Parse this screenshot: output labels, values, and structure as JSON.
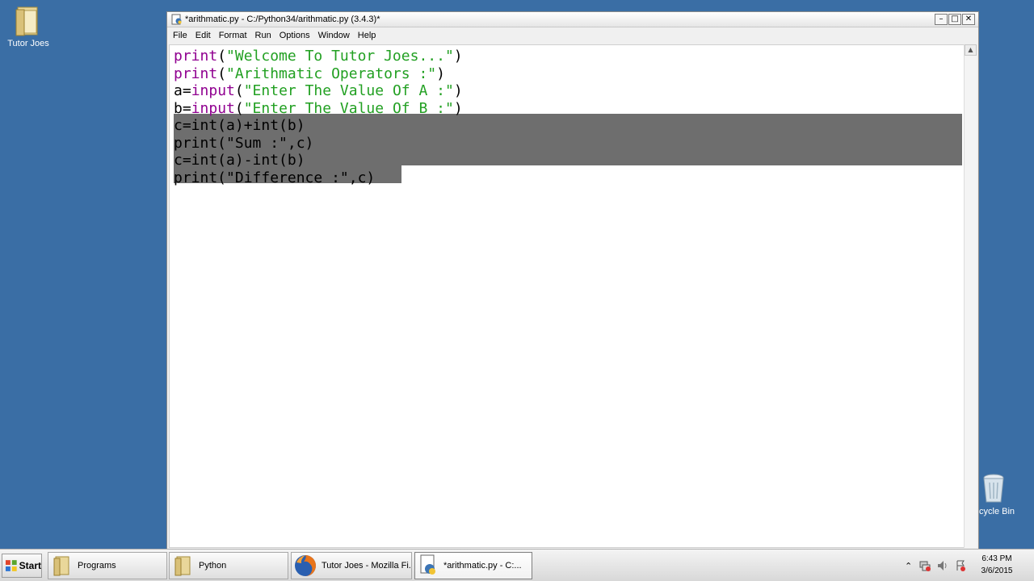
{
  "desktop": {
    "icons": [
      {
        "label": "Tutor Joes"
      },
      {
        "label": "cycle Bin"
      }
    ]
  },
  "window": {
    "title": "*arithmatic.py - C:/Python34/arithmatic.py (3.4.3)*",
    "controls": {
      "minimize": "–",
      "maximize": "□",
      "close": "✕"
    },
    "menu": [
      "File",
      "Edit",
      "Format",
      "Run",
      "Options",
      "Window",
      "Help"
    ]
  },
  "editor": {
    "lines": [
      [
        {
          "t": "print",
          "c": "kw"
        },
        {
          "t": "(",
          "c": "plain"
        },
        {
          "t": "\"Welcome To Tutor Joes...\"",
          "c": "str"
        },
        {
          "t": ")",
          "c": "plain"
        }
      ],
      [
        {
          "t": "print",
          "c": "kw"
        },
        {
          "t": "(",
          "c": "plain"
        },
        {
          "t": "\"Arithmatic Operators :\"",
          "c": "str"
        },
        {
          "t": ")",
          "c": "plain"
        }
      ],
      [
        {
          "t": "a=",
          "c": "plain"
        },
        {
          "t": "input",
          "c": "kw"
        },
        {
          "t": "(",
          "c": "plain"
        },
        {
          "t": "\"Enter The Value Of A :\"",
          "c": "str"
        },
        {
          "t": ")",
          "c": "plain"
        }
      ],
      [
        {
          "t": "b=",
          "c": "plain"
        },
        {
          "t": "input",
          "c": "kw"
        },
        {
          "t": "(",
          "c": "plain"
        },
        {
          "t": "\"Enter The Value Of B :\"",
          "c": "str"
        },
        {
          "t": ")",
          "c": "plain"
        }
      ],
      [
        {
          "t": "c=int(a)+int(b)",
          "c": "plain"
        }
      ],
      [
        {
          "t": "print(\"Sum :\",c)",
          "c": "plain"
        }
      ],
      [
        {
          "t": "c=int(a)-int(b)",
          "c": "plain"
        }
      ],
      [
        {
          "t": "print(\"Difference :\",c)",
          "c": "plain"
        }
      ]
    ]
  },
  "taskbar": {
    "start_label": "Start",
    "buttons": [
      {
        "label": "Programs"
      },
      {
        "label": "Python"
      },
      {
        "label": "Tutor Joes - Mozilla Fi..."
      },
      {
        "label": "*arithmatic.py - C:..."
      }
    ],
    "tray_arrow": "⌃",
    "clock": {
      "time": "6:43 PM",
      "date": "3/6/2015"
    }
  },
  "colors": {
    "desktop": "#3a6ea5",
    "keyword": "#900090",
    "string": "#22a022",
    "selection": "#6e6e6e"
  }
}
